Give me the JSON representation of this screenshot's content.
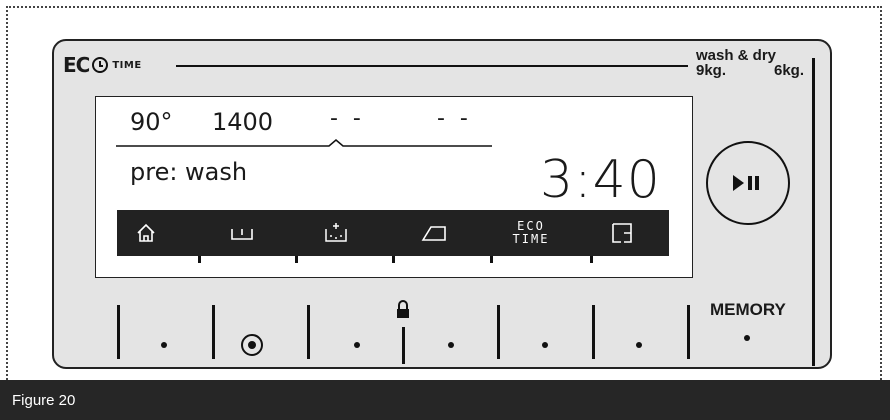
{
  "logo": {
    "brand": "EC",
    "small": "TIME"
  },
  "capacity": {
    "title": "wash & dry",
    "wash": "9kg.",
    "dry": "6kg."
  },
  "display": {
    "temperature": "90°",
    "spin": "1400",
    "option3": "- -",
    "option4": "- -",
    "program": "pre: wash",
    "time": "3:40"
  },
  "icon_bar": {
    "icons": [
      "home-icon",
      "basket-icon",
      "prewash-icon",
      "iron-icon",
      "eco-time-label",
      "delay-timer-icon"
    ],
    "eco_line1": "ECO",
    "eco_line2": "TIME"
  },
  "controls": {
    "play_icon": "play-pause-icon",
    "memory": "MEMORY",
    "lock_icon": "lock-icon"
  },
  "caption": "Figure 20",
  "colors": {
    "panel": "#e4e4e4",
    "bar": "#222222",
    "caption_bg": "#262626"
  }
}
